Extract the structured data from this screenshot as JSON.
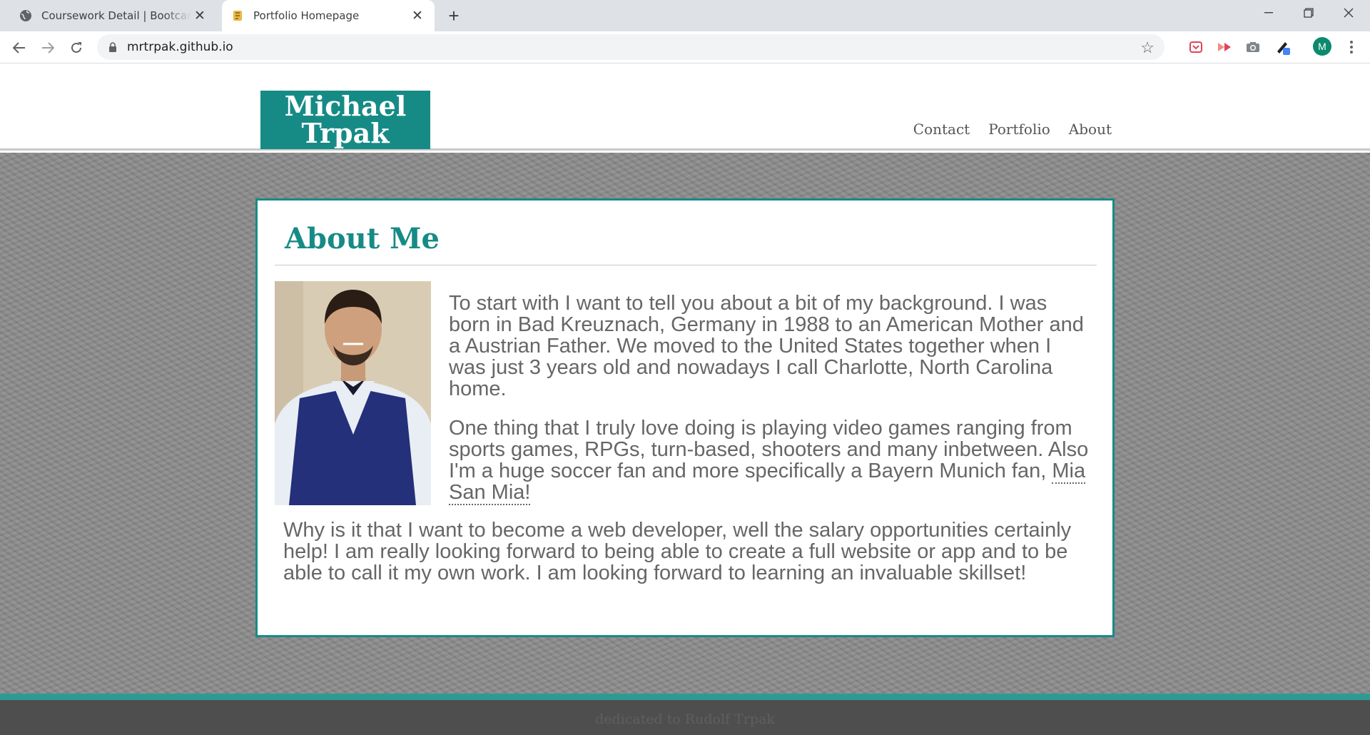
{
  "browser": {
    "tabs": [
      {
        "title": "Coursework Detail | Bootcamp Spot",
        "active": false
      },
      {
        "title": "Portfolio Homepage",
        "active": true
      }
    ],
    "url": "mrtrpak.github.io",
    "profile_initial": "M",
    "icons": {
      "back": "arrow-left-icon",
      "forward": "arrow-right-icon",
      "reload": "reload-icon",
      "bookmark": "star-icon"
    }
  },
  "site": {
    "logo": {
      "line1": "Michael",
      "line2": "Trpak"
    },
    "nav": [
      "Contact",
      "Portfolio",
      "About"
    ],
    "about": {
      "heading": "About Me",
      "p1": "To start with I want to tell you about a bit of my background. I was born in Bad Kreuznach, Germany in 1988 to an American Mother and a Austrian Father. We moved to the United States together when I was just 3 years old and nowadays I call Charlotte, North Carolina home.",
      "p2_text": "One thing that I truly love doing is playing video games ranging from sports games, RPGs, turn-based, shooters and many inbetween. Also I'm a huge soccer fan and more specifically a Bayern Munich fan, ",
      "p2_link": "Mia San Mia!",
      "p3": "Why is it that I want to become a web developer, well the salary opportunities certainly help! I am really looking forward to being able to create a full website or app and to be able to call it my own work. I am looking forward to learning an invaluable skillset!"
    },
    "footer": "dedicated to Rudolf Trpak",
    "colors": {
      "accent": "#168b86",
      "footer_line": "#2e9b93",
      "footer_bg": "#4e4e4e"
    }
  }
}
